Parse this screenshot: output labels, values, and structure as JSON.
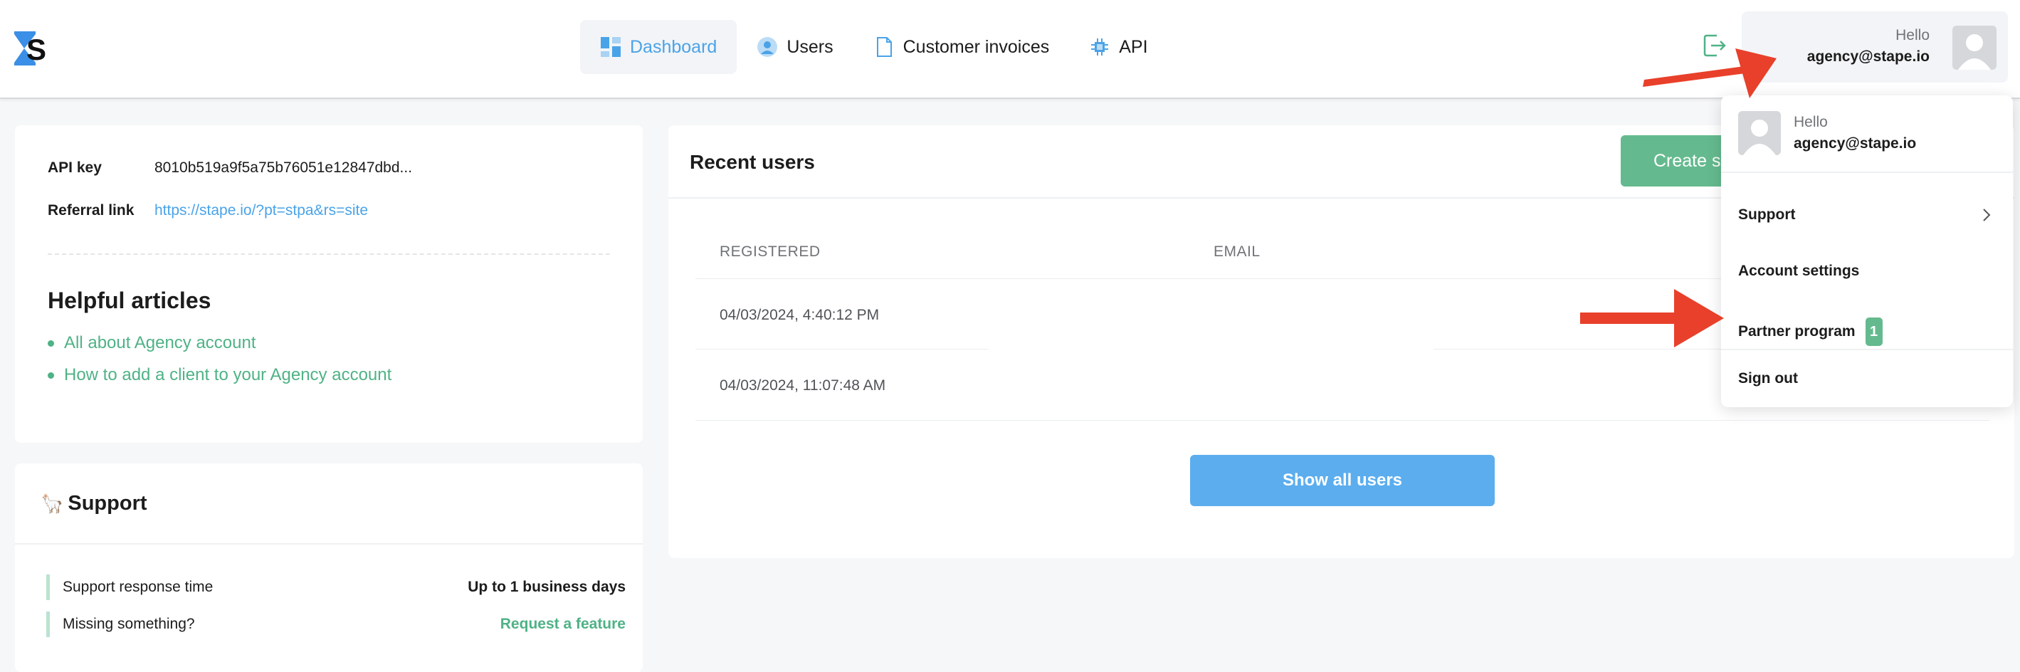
{
  "header": {
    "nav": [
      {
        "label": "Dashboard",
        "icon": "dashboard-icon"
      },
      {
        "label": "Users",
        "icon": "user-icon"
      },
      {
        "label": "Customer invoices",
        "icon": "document-icon"
      },
      {
        "label": "API",
        "icon": "chip-icon"
      }
    ],
    "user": {
      "hello": "Hello",
      "email": "agency@stape.io"
    }
  },
  "api_card": {
    "api_key_label": "API key",
    "api_key_value": "8010b519a9f5a75b76051e12847dbd...",
    "referral_label": "Referral link",
    "referral_value": "https://stape.io/?pt=stpa&rs=site",
    "articles_title": "Helpful articles",
    "articles": [
      "All about Agency account",
      "How to add a client to your Agency account"
    ]
  },
  "support_card": {
    "title": "Support",
    "rows": [
      {
        "label": "Support response time",
        "value": "Up to 1 business days"
      },
      {
        "label": "Missing something?",
        "value": "Request a feature"
      }
    ]
  },
  "users_card": {
    "title": "Recent users",
    "create_label": "Create s",
    "columns": [
      "REGISTERED",
      "EMAIL"
    ],
    "rows": [
      {
        "registered": "04/03/2024, 4:40:12 PM"
      },
      {
        "registered": "04/03/2024, 11:07:48 AM"
      }
    ],
    "show_all_label": "Show all users"
  },
  "dropdown": {
    "hello": "Hello",
    "email": "agency@stape.io",
    "items": [
      "Support",
      "Account settings",
      "Partner program",
      "Sign out"
    ],
    "partner_badge": "1"
  },
  "colors": {
    "accent_blue": "#4aa3e8",
    "accent_green": "#64ba8e",
    "annotation_arrow": "#e8402a"
  }
}
